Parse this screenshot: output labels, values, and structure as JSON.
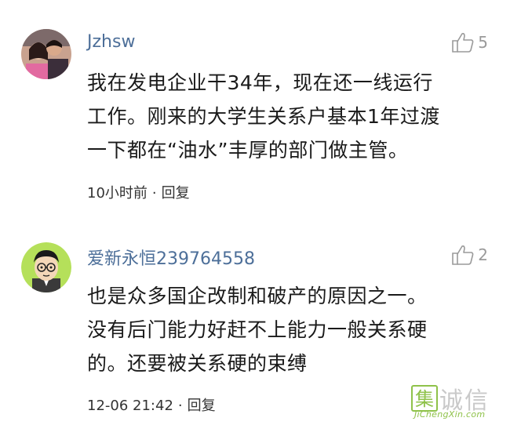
{
  "comments": [
    {
      "username": "Jzhsw",
      "likes": "5",
      "lines": [
        "我在发电企业干34年，现在还一线运行",
        "工作。刚来的大学生关系户基本1年过渡",
        "一下都在“油水”丰厚的部门做主管。"
      ],
      "time": "10小时前",
      "dot": "·",
      "reply": "回复"
    },
    {
      "username": "爱新永恒239764558",
      "likes": "2",
      "lines": [
        "也是众多国企改制和破产的原因之一。",
        "没有后门能力好赶不上能力一般关系硬",
        "的。还要被关系硬的束缚"
      ],
      "time": "12-06 21:42",
      "dot": "·",
      "reply": "回复"
    }
  ],
  "watermark": {
    "box_char": "集",
    "chars": "诚信",
    "url": "JiChengXin.com"
  },
  "colors": {
    "username": "#4d6f99",
    "like_icon": "#9a9a9a",
    "watermark_green": "#8fc24a"
  },
  "icons": {
    "like": "thumbs-up-icon"
  }
}
